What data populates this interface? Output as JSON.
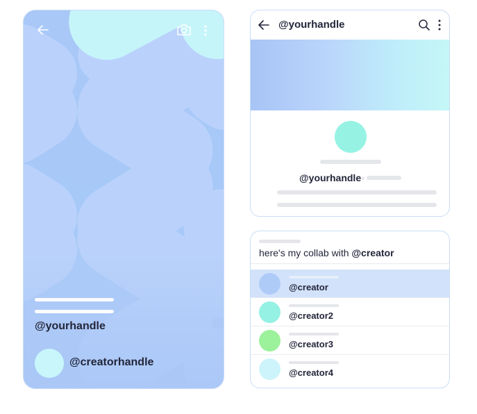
{
  "left_story": {
    "handle": "@yourhandle",
    "creator_handle": "@creatorhandle",
    "colors": {
      "background": "#a9c8f7",
      "shape": "#bad2fb",
      "accent_shape": "#c6f5f9",
      "avatar": "#c8f6fb"
    },
    "icons": {
      "back": "arrow-left-icon",
      "camera": "camera-icon",
      "more": "more-vertical-icon"
    }
  },
  "profile_card": {
    "title": "@yourhandle",
    "handle": "@yourhandle",
    "colors": {
      "avatar": "#96f3e4",
      "banner_start": "#a7c4f5",
      "banner_end": "#c4f7f6"
    },
    "icons": {
      "back": "arrow-left-icon",
      "search": "search-icon",
      "more": "more-vertical-icon"
    }
  },
  "mention_card": {
    "comment_prefix": "here's my collab with ",
    "comment_mention": "@creator",
    "suggestions": [
      {
        "name": "@creator",
        "avatar_color": "#aecbf8",
        "selected": true
      },
      {
        "name": "@creator2",
        "avatar_color": "#95f1e4",
        "selected": false
      },
      {
        "name": "@creator3",
        "avatar_color": "#9cf19b",
        "selected": false
      },
      {
        "name": "@creator4",
        "avatar_color": "#cdf4fa",
        "selected": false
      }
    ],
    "colors": {
      "selected_row": "#d2e2fb"
    }
  }
}
